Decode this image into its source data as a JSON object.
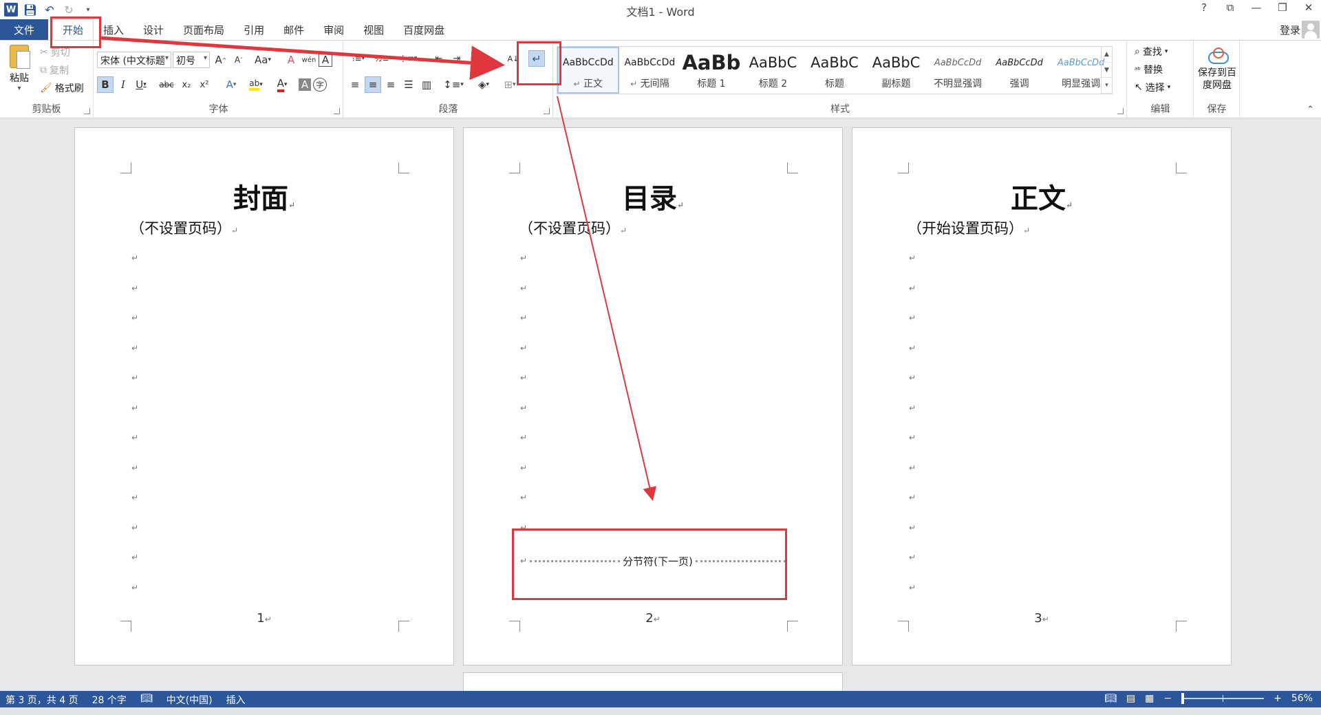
{
  "titlebar": {
    "title": "文档1 - Word",
    "controls": [
      "?",
      "⧉",
      "—",
      "❐",
      "✕"
    ]
  },
  "tabs": {
    "file": "文件",
    "items": [
      "开始",
      "插入",
      "设计",
      "页面布局",
      "引用",
      "邮件",
      "审阅",
      "视图",
      "百度网盘"
    ],
    "active_index": 0,
    "login": "登录"
  },
  "clipboard": {
    "paste": "粘贴",
    "cut": "剪切",
    "copy": "复制",
    "format_painter": "格式刷",
    "label": "剪贴板"
  },
  "font": {
    "font_name": "宋体 (中文标题",
    "font_size": "初号",
    "label": "字体",
    "bold": "B",
    "italic": "I",
    "underline": "U",
    "strike": "abc",
    "subscript": "x₂",
    "superscript": "x²",
    "grow": "A",
    "shrink": "A",
    "case": "Aa",
    "clear": "A",
    "phonetic": "wén",
    "char_border": "A",
    "text_effect": "A",
    "highlight": "ab",
    "font_color": "A",
    "char_shade": "A",
    "enclose": "字"
  },
  "paragraph": {
    "label": "段落",
    "sort": "A↓",
    "show_marks": "↵"
  },
  "styles": {
    "label": "样式",
    "items": [
      {
        "sample": "AaBbCcDd",
        "name": "正文"
      },
      {
        "sample": "AaBbCcDd",
        "name": "无间隔"
      },
      {
        "sample": "AaBb",
        "name": "标题 1"
      },
      {
        "sample": "AaBbC",
        "name": "标题 2"
      },
      {
        "sample": "AaBbC",
        "name": "标题"
      },
      {
        "sample": "AaBbC",
        "name": "副标题"
      },
      {
        "sample": "AaBbCcDd",
        "name": "不明显强调"
      },
      {
        "sample": "AaBbCcDd",
        "name": "强调"
      },
      {
        "sample": "AaBbCcDd",
        "name": "明显强调"
      }
    ]
  },
  "editing": {
    "find": "查找",
    "replace": "替换",
    "select": "选择",
    "label": "编辑"
  },
  "save": {
    "button": "保存到百度网盘",
    "label": "保存"
  },
  "pages": [
    {
      "title": "封面",
      "subtitle": "（不设置页码）",
      "number": "1"
    },
    {
      "title": "目录",
      "subtitle": "（不设置页码）",
      "number": "2",
      "section_break": "分节符(下一页)"
    },
    {
      "title": "正文",
      "subtitle": "（开始设置页码）",
      "number": "3"
    }
  ],
  "statusbar": {
    "page": "第 3 页，共 4 页",
    "words": "28 个字",
    "language": "中文(中国)",
    "mode": "插入",
    "zoom": "56%"
  },
  "colors": {
    "brand": "#2b579a",
    "annotation": "#e0373f"
  }
}
